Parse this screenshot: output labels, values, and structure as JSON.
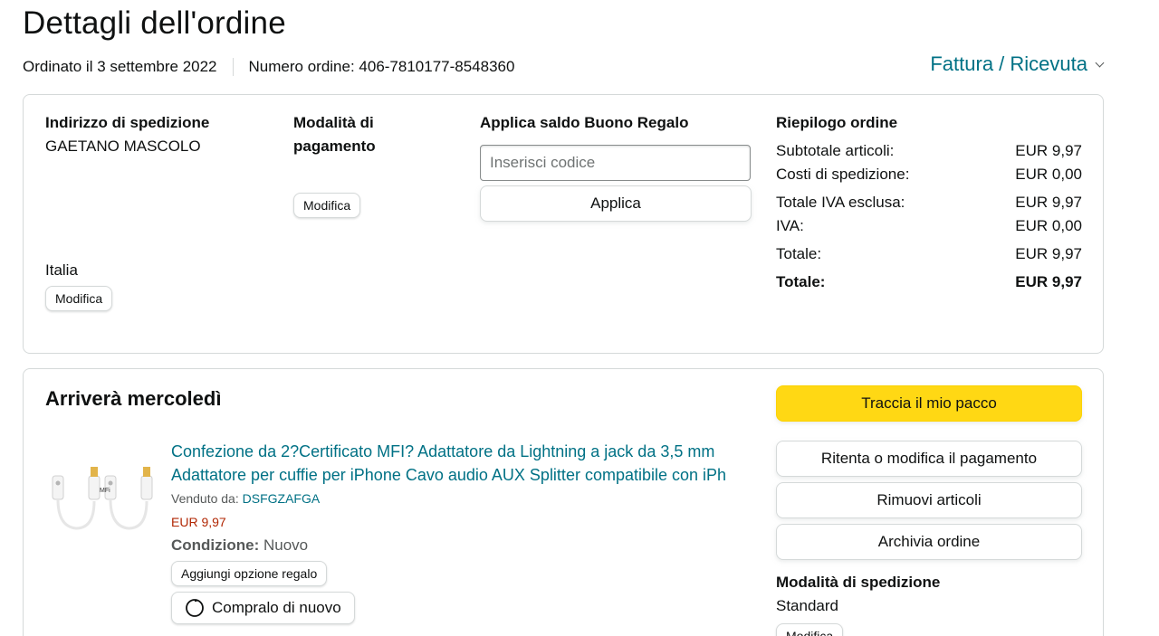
{
  "header": {
    "title": "Dettagli dell'ordine",
    "ordered_on": "Ordinato il 3 settembre 2022",
    "order_number": "Numero ordine: 406-7810177-8548360",
    "invoice_link": "Fattura / Ricevuta"
  },
  "shipping_address": {
    "heading": "Indirizzo di spedizione",
    "name": "GAETANO MASCOLO",
    "country": "Italia",
    "edit_label": "Modifica"
  },
  "payment": {
    "heading": "Modalità di pagamento",
    "edit_label": "Modifica"
  },
  "gift_card": {
    "heading": "Applica saldo Buono Regalo",
    "placeholder": "Inserisci codice",
    "apply_label": "Applica"
  },
  "summary": {
    "heading": "Riepilogo ordine",
    "rows": [
      {
        "label": "Subtotale articoli:",
        "value": "EUR 9,97"
      },
      {
        "label": "Costi di spedizione:",
        "value": "EUR 0,00"
      },
      {
        "label": "Totale IVA esclusa:",
        "value": "EUR 9,97"
      },
      {
        "label": "IVA:",
        "value": "EUR 0,00"
      },
      {
        "label": "Totale:",
        "value": "EUR 9,97"
      },
      {
        "label": "Totale:",
        "value": "EUR 9,97"
      }
    ]
  },
  "shipment": {
    "arrival": "Arriverà mercoledì",
    "product_title": "Confezione da 2?Certificato MFI? Adattatore da Lightning a jack da 3,5 mm Adattatore per cuffie per iPhone Cavo audio AUX Splitter compatibile con iPh",
    "sold_by_label": "Venduto da:",
    "seller": "DSFGZAFGA",
    "price": "EUR 9,97",
    "condition_label": "Condizione:",
    "condition_value": "Nuovo",
    "gift_option_label": "Aggiungi opzione regalo",
    "buy_again_label": "Compralo di nuovo",
    "image_text": "MFi"
  },
  "actions": {
    "track": "Traccia il mio pacco",
    "retry_payment": "Ritenta o modifica il pagamento",
    "remove_items": "Rimuovi articoli",
    "archive": "Archivia ordine",
    "shipping_method_heading": "Modalità di spedizione",
    "shipping_method": "Standard",
    "shipping_edit_label": "Modifica"
  },
  "colors": {
    "link": "#007185",
    "price": "#b12704",
    "primary_button": "#ffd814",
    "border": "#d5d9d9"
  }
}
